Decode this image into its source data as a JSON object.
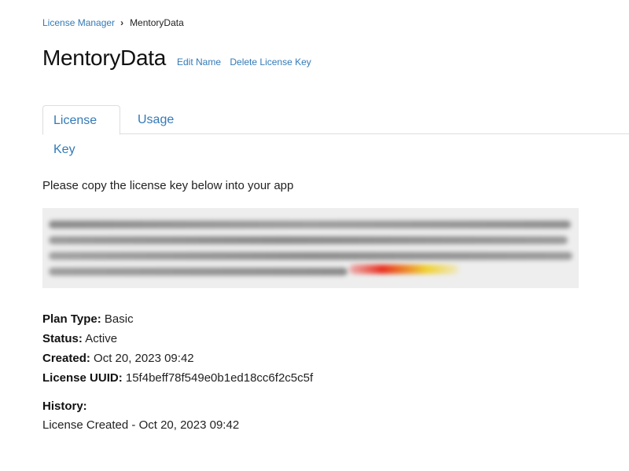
{
  "breadcrumb": {
    "parent": "License Manager",
    "separator": "›",
    "current": "MentoryData"
  },
  "header": {
    "title": "MentoryData",
    "edit_name": "Edit Name",
    "delete_key": "Delete License Key"
  },
  "tabs": [
    {
      "label": "License Key",
      "active": true
    },
    {
      "label": "Usage",
      "active": false
    }
  ],
  "main": {
    "instruction": "Please copy the license key below into your app"
  },
  "details": {
    "plan_type_label": "Plan Type:",
    "plan_type_value": "Basic",
    "status_label": "Status:",
    "status_value": "Active",
    "created_label": "Created:",
    "created_value": "Oct 20, 2023 09:42",
    "uuid_label": "License UUID:",
    "uuid_value": "15f4beff78f549e0b1ed18cc6f2c5c5f"
  },
  "history": {
    "label": "History:",
    "entries": [
      "License Created - Oct 20, 2023 09:42"
    ]
  },
  "colors": {
    "link": "#337ab7",
    "key_background": "#eeeeee",
    "tab_border": "#dddddd"
  }
}
